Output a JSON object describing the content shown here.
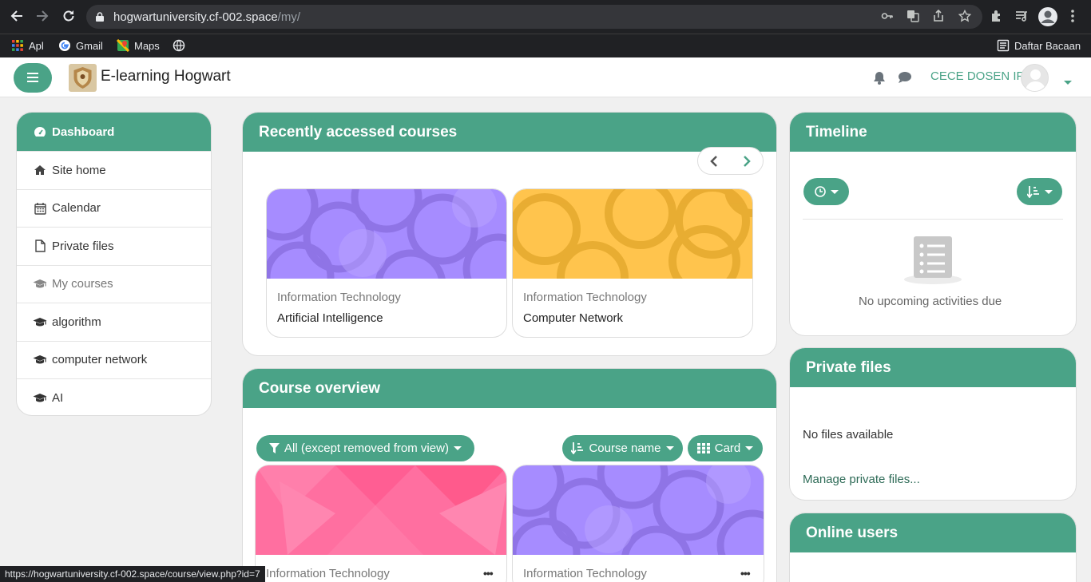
{
  "browser": {
    "url_host": "hogwartuniversity.cf-002.space",
    "url_path": "/my/",
    "bookmarks": [
      {
        "label": "Apl",
        "icon": "apps-grid-icon"
      },
      {
        "label": "Gmail",
        "icon": "google-g-icon"
      },
      {
        "label": "Maps",
        "icon": "maps-icon"
      },
      {
        "label": "",
        "icon": "globe-icon"
      }
    ],
    "reading_list": "Daftar Bacaan",
    "status_url": "https://hogwartuniversity.cf-002.space/course/view.php?id=7"
  },
  "navbar": {
    "site_name": "E-learning Hogwart",
    "user_name": "CECE DOSEN IF"
  },
  "leftnav": {
    "items": [
      {
        "label": "Dashboard",
        "icon": "dashboard-icon",
        "state": "active"
      },
      {
        "label": "Site home",
        "icon": "home-icon",
        "state": "normal"
      },
      {
        "label": "Calendar",
        "icon": "calendar-icon",
        "state": "normal"
      },
      {
        "label": "Private files",
        "icon": "file-icon",
        "state": "normal"
      },
      {
        "label": "My courses",
        "icon": "graduation-cap-icon",
        "state": "muted"
      },
      {
        "label": "algorithm",
        "icon": "graduation-cap-icon",
        "state": "normal"
      },
      {
        "label": "computer network",
        "icon": "graduation-cap-icon",
        "state": "normal"
      },
      {
        "label": "AI",
        "icon": "graduation-cap-icon",
        "state": "normal"
      }
    ]
  },
  "recent": {
    "title": "Recently accessed courses",
    "courses": [
      {
        "category": "Information Technology",
        "name": "Artificial Intelligence",
        "color": "#a68cff"
      },
      {
        "category": "Information Technology",
        "name": "Computer Network",
        "color": "#ffc44d"
      }
    ]
  },
  "overview": {
    "title": "Course overview",
    "filter": "All (except removed from view)",
    "sort": "Course name",
    "view": "Card",
    "courses": [
      {
        "category": "Information Technology",
        "color": "#ff6fa0"
      },
      {
        "category": "Information Technology",
        "color": "#a68cff"
      }
    ]
  },
  "timeline": {
    "title": "Timeline",
    "empty": "No upcoming activities due"
  },
  "private_files": {
    "title": "Private files",
    "empty": "No files available",
    "manage": "Manage private files..."
  },
  "online_users": {
    "title": "Online users"
  },
  "colors": {
    "accent": "#4aa387"
  }
}
